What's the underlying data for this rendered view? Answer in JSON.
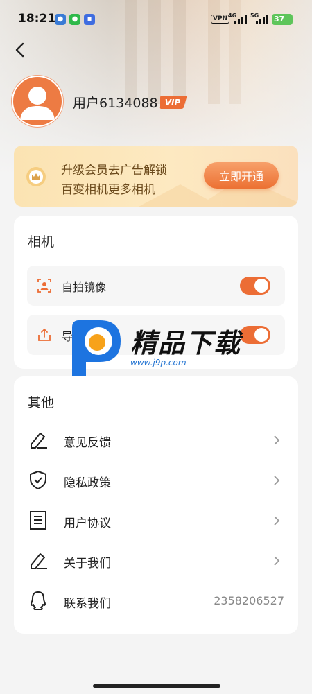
{
  "status_bar": {
    "time": "18:21",
    "vpn": "VPN",
    "signal_1": "4G",
    "signal_2": "5G",
    "battery": "37"
  },
  "profile": {
    "username": "用户6134088",
    "vip_badge": "VIP"
  },
  "banner": {
    "line1": "升级会员去广告解锁",
    "line2": "百变相机更多相机",
    "button": "立即开通"
  },
  "camera_section": {
    "title": "相机",
    "rows": [
      {
        "label": "自拍镜像",
        "icon": "selfie-mirror-icon",
        "enabled": true
      },
      {
        "label": "导出到相册",
        "icon": "export-icon",
        "enabled": true
      }
    ]
  },
  "other_section": {
    "title": "其他",
    "items": [
      {
        "label": "意见反馈",
        "icon": "pencil-icon"
      },
      {
        "label": "隐私政策",
        "icon": "shield-check-icon"
      },
      {
        "label": "用户协议",
        "icon": "document-icon"
      },
      {
        "label": "关于我们",
        "icon": "pencil-icon"
      },
      {
        "label": "联系我们",
        "icon": "qq-icon",
        "value": "2358206527"
      }
    ]
  },
  "watermark": {
    "title": "精品下载",
    "url": "www.j9p.com"
  },
  "colors": {
    "accent": "#ec6d35",
    "background": "#f4f4f4",
    "banner_text": "#6b4a1c"
  }
}
